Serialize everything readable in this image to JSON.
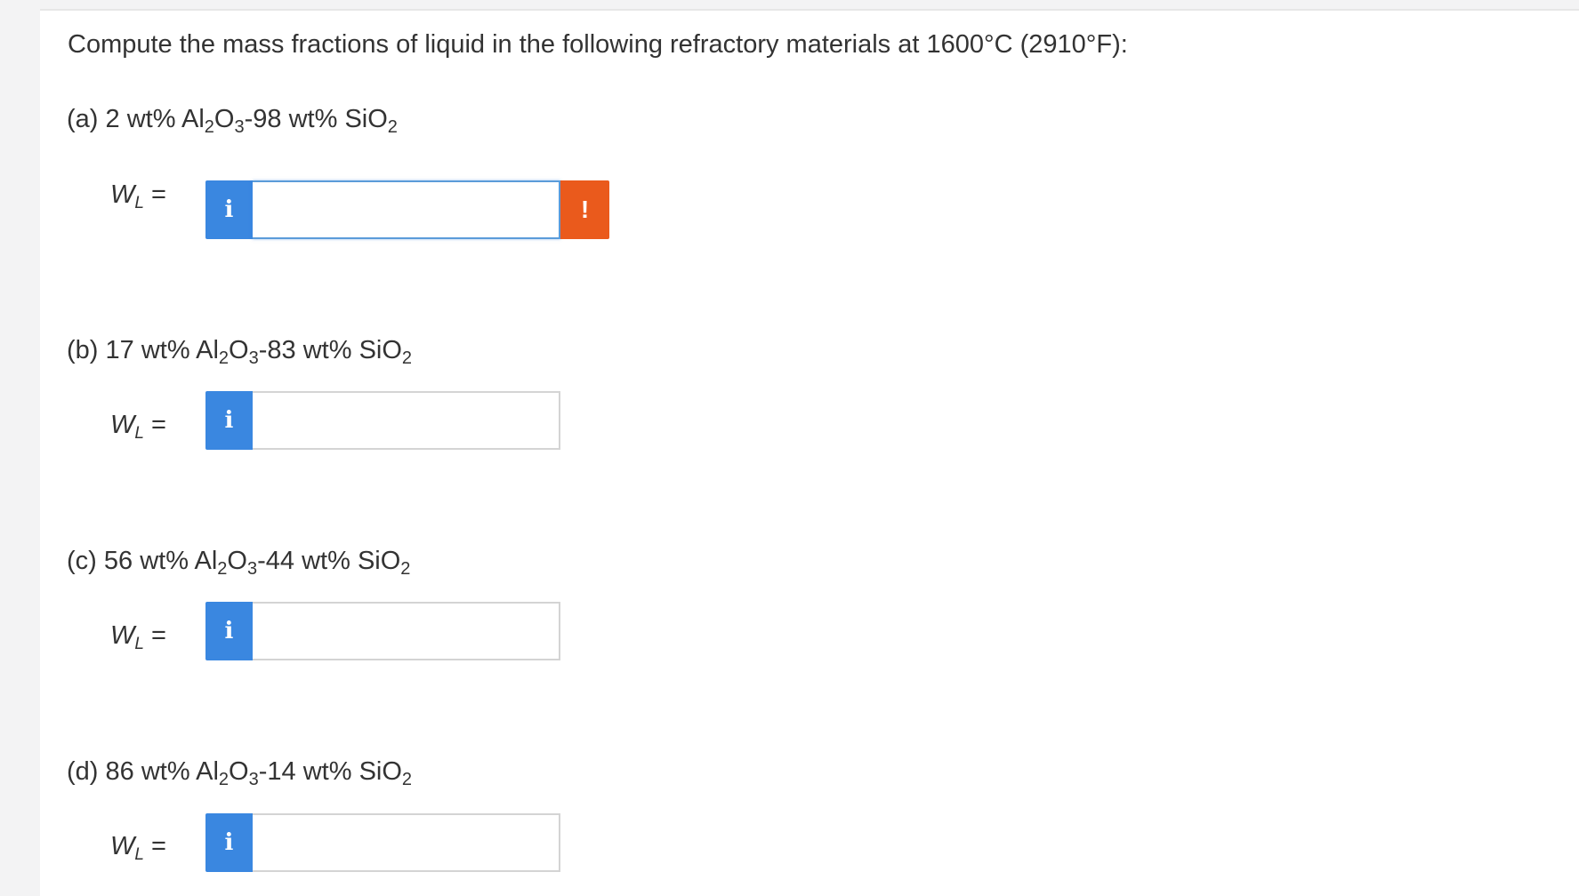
{
  "prompt": "Compute the mass fractions of liquid in the following refractory materials at 1600°C (2910°F):",
  "parts": [
    {
      "letter": "(a)",
      "al_pct": "2",
      "si_pct": "98",
      "label": "W",
      "label_sub": "L",
      "equals": "=",
      "info_icon_glyph": "i",
      "value": "",
      "alert_icon_glyph": "!"
    },
    {
      "letter": "(b)",
      "al_pct": "17",
      "si_pct": "83",
      "label": "W",
      "label_sub": "L",
      "equals": "=",
      "info_icon_glyph": "i",
      "value": ""
    },
    {
      "letter": "(c)",
      "al_pct": "56",
      "si_pct": "44",
      "label": "W",
      "label_sub": "L",
      "equals": "=",
      "info_icon_glyph": "i",
      "value": ""
    },
    {
      "letter": "(d)",
      "al_pct": "86",
      "si_pct": "14",
      "label": "W",
      "label_sub": "L",
      "equals": "=",
      "info_icon_glyph": "i",
      "value": ""
    }
  ],
  "formula": {
    "unit": "wt%",
    "al_main": "Al",
    "al_sub": "2",
    "o": "O",
    "al_o_sub": "3",
    "dash": "-",
    "si_main": "SiO",
    "si_sub": "2"
  },
  "colors": {
    "info_button": "#3a87e0",
    "alert_button": "#ea5a1c",
    "active_border": "#5b9bd9",
    "text": "#333333"
  }
}
